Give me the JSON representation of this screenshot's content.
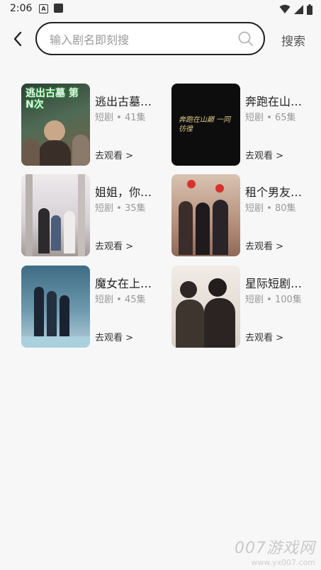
{
  "status_bar": {
    "time": "2:06",
    "badge": "A"
  },
  "header": {
    "search_placeholder": "输入剧名即刻搜",
    "search_button": "搜索"
  },
  "dramas": [
    {
      "title": "逃出古墓…",
      "genre": "短剧",
      "episodes": "41集",
      "action": "去观看 >",
      "poster_text": "逃出古墓 第N次",
      "poster_colors": [
        "#2c3f32",
        "#5c7a63"
      ]
    },
    {
      "title": "奔跑在山…",
      "genre": "短剧",
      "episodes": "65集",
      "action": "去观看 >",
      "poster_text": "奔跑在山巅 一同彷徨",
      "poster_colors": [
        "#0d0d0d",
        "#1a1a1a"
      ]
    },
    {
      "title": "姐姐，你…",
      "genre": "短剧",
      "episodes": "35集",
      "action": "去观看 >",
      "poster_text": "",
      "poster_colors": [
        "#e9e6e8",
        "#7d6f69"
      ]
    },
    {
      "title": "租个男友…",
      "genre": "短剧",
      "episodes": "80集",
      "action": "去观看 >",
      "poster_text": "",
      "poster_colors": [
        "#d9c3b2",
        "#7a4a3c"
      ]
    },
    {
      "title": "魔女在上…",
      "genre": "短剧",
      "episodes": "45集",
      "action": "去观看 >",
      "poster_text": "",
      "poster_colors": [
        "#3f6c85",
        "#9dbfcf"
      ]
    },
    {
      "title": "星际短剧…",
      "genre": "短剧",
      "episodes": "100集",
      "action": "去观看 >",
      "poster_text": "",
      "poster_colors": [
        "#efe9e3",
        "#3a312d"
      ]
    }
  ],
  "watermark": {
    "main": "007游戏网",
    "sub": "www.yx007.com"
  }
}
